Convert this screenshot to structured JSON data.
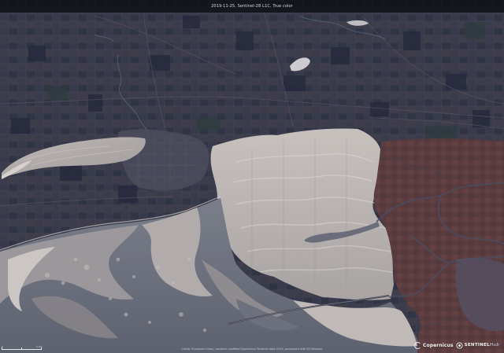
{
  "header": {
    "title": "2019-11-25, Sentinel-2B L1C, True color"
  },
  "footer": {
    "attribution": "Credit: European Union, contains modified Copernicus Sentinel data 2019, processed with EO Browser"
  },
  "scale": {
    "label_start": "0",
    "label_end": "1 km"
  },
  "logos": {
    "copernicus": "Copernicus",
    "sentinel": "SENTINEL",
    "sentinel_suffix": "Hub"
  }
}
